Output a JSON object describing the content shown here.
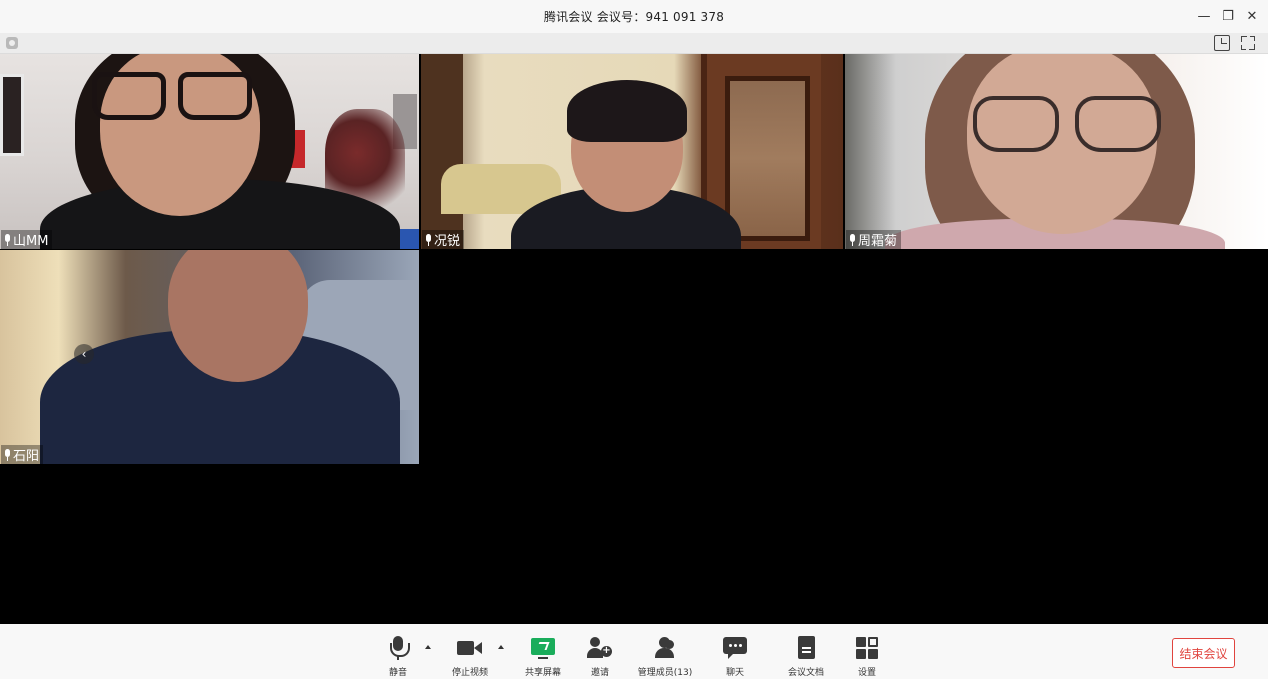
{
  "window": {
    "title": "腾讯会议 会议号：941 091 378",
    "controls": {
      "minimize": "—",
      "restore": "❐",
      "close": "✕"
    }
  },
  "participants": [
    {
      "name": "山MM",
      "mic": "mic-icon"
    },
    {
      "name": "况锐",
      "mic": "mic-icon"
    },
    {
      "name": "周霜菊",
      "mic": "mic-icon"
    },
    {
      "name": "石阳",
      "mic": "mic-icon"
    }
  ],
  "gallery": {
    "prev_arrow": "‹"
  },
  "toolbar": {
    "items": [
      {
        "label": "静音",
        "icon": "microphone-icon"
      },
      {
        "label": "停止视频",
        "icon": "video-camera-icon"
      },
      {
        "label": "共享屏幕",
        "icon": "share-screen-icon"
      },
      {
        "label": "邀请",
        "icon": "invite-user-icon"
      },
      {
        "label": "管理成员(13)",
        "icon": "members-icon"
      },
      {
        "label": "聊天",
        "icon": "chat-icon"
      },
      {
        "label": "会议文档",
        "icon": "document-icon"
      },
      {
        "label": "设置",
        "icon": "settings-grid-icon"
      }
    ],
    "end_label": "结束会议"
  },
  "colors": {
    "accent_green": "#1aad5b",
    "end_red": "#e0443e"
  }
}
